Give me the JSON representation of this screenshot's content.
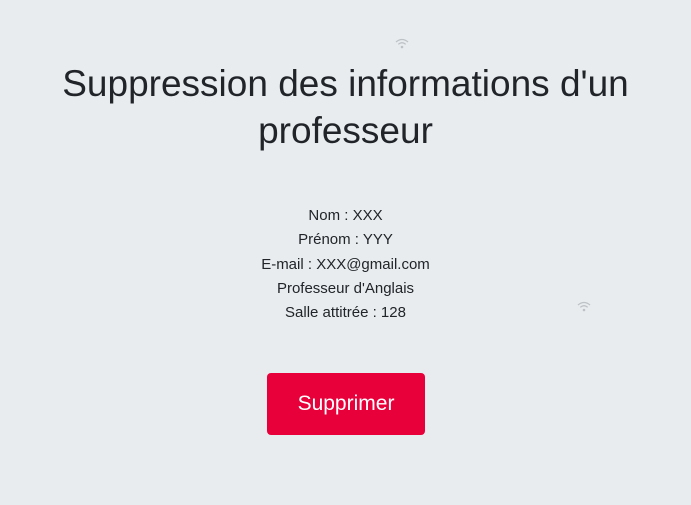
{
  "page": {
    "title": "Suppression des informations d'un professeur"
  },
  "teacher": {
    "nom": "Nom : XXX",
    "prenom": "Prénom : YYY",
    "email": "E-mail : XXX@gmail.com",
    "role": "Professeur d'Anglais",
    "salle": "Salle attitrée : 128"
  },
  "actions": {
    "delete_label": "Supprimer"
  },
  "colors": {
    "background": "#e9ecef",
    "danger": "#e8003a",
    "text": "#212529"
  },
  "icons": [
    "wifi-icon",
    "wifi-icon"
  ]
}
